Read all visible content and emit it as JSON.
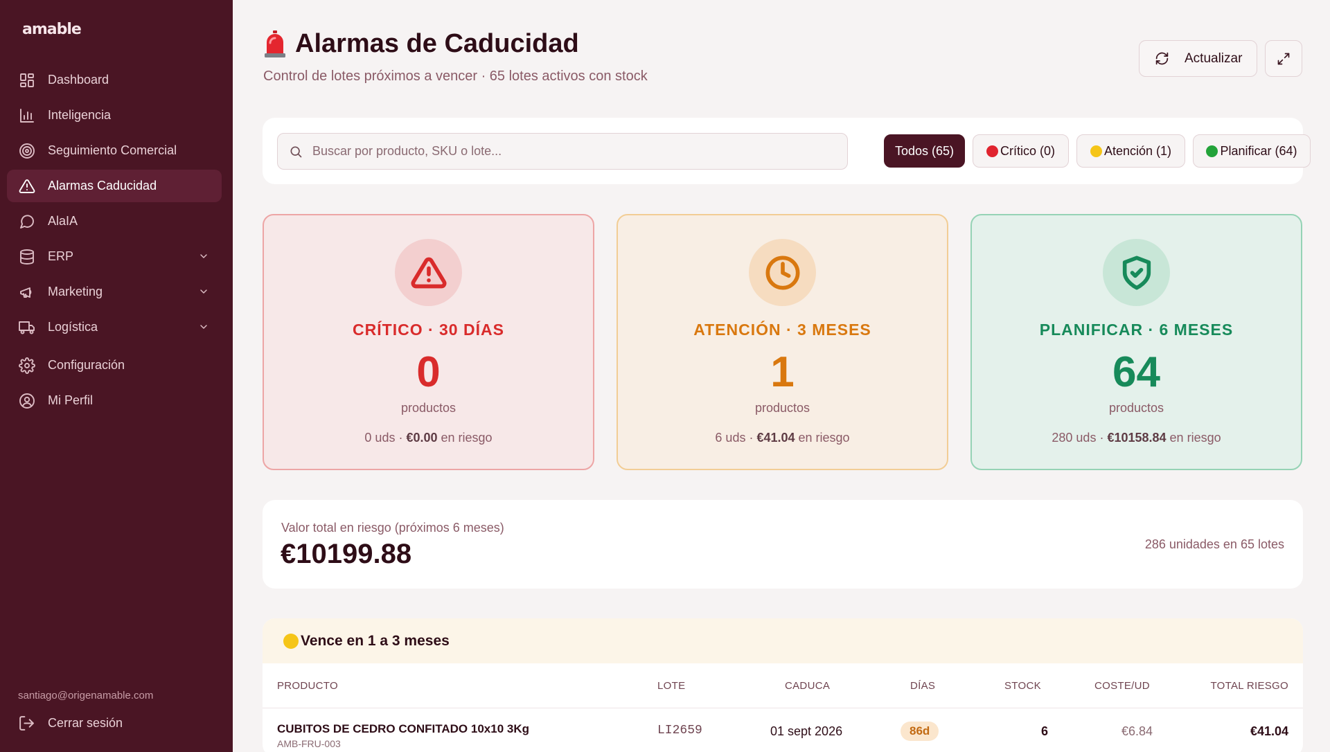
{
  "app": {
    "logo": "amable"
  },
  "sidebar": {
    "items": [
      {
        "label": "Dashboard",
        "icon": "dashboard-icon"
      },
      {
        "label": "Inteligencia",
        "icon": "bar-chart-icon"
      },
      {
        "label": "Seguimiento Comercial",
        "icon": "target-icon"
      },
      {
        "label": "Alarmas Caducidad",
        "icon": "alert-triangle-icon",
        "active": true
      },
      {
        "label": "AlaIA",
        "icon": "message-circle-icon"
      },
      {
        "label": "ERP",
        "icon": "database-icon",
        "expandable": true
      },
      {
        "label": "Marketing",
        "icon": "megaphone-icon",
        "expandable": true
      },
      {
        "label": "Logística",
        "icon": "truck-icon",
        "expandable": true
      },
      {
        "label": "Configuración",
        "icon": "gear-icon"
      },
      {
        "label": "Mi Perfil",
        "icon": "user-circle-icon"
      }
    ],
    "user_email": "santiago@origenamable.com",
    "logout_label": "Cerrar sesión"
  },
  "header": {
    "title": "Alarmas de Caducidad",
    "subtitle": "Control de lotes próximos a vencer · 65 lotes activos con stock",
    "refresh_label": "Actualizar"
  },
  "filters": {
    "search_placeholder": "Buscar por producto, SKU o lote...",
    "search_value": "",
    "chips": [
      {
        "label": "Todos (65)",
        "active": true
      },
      {
        "label": "Crítico (0)",
        "dot_color": "#e0242f"
      },
      {
        "label": "Atención (1)",
        "dot_color": "#f5c518"
      },
      {
        "label": "Planificar (64)",
        "dot_color": "#23a33a"
      }
    ]
  },
  "cards": [
    {
      "title": "CRÍTICO · 30 DÍAS",
      "count": "0",
      "unit": "productos",
      "units": "0 uds · ",
      "value": "€0.00",
      "risk_suffix": " en riesgo",
      "icon": "alert-triangle-icon",
      "color": "#d92b2b"
    },
    {
      "title": "ATENCIÓN · 3 MESES",
      "count": "1",
      "unit": "productos",
      "units": "6 uds · ",
      "value": "€41.04",
      "risk_suffix": " en riesgo",
      "icon": "clock-icon",
      "color": "#d9780f"
    },
    {
      "title": "PLANIFICAR · 6 MESES",
      "count": "64",
      "unit": "productos",
      "units": "280 uds · ",
      "value": "€10158.84",
      "risk_suffix": " en riesgo",
      "icon": "shield-check-icon",
      "color": "#178a5a"
    }
  ],
  "total": {
    "label": "Valor total en riesgo (próximos 6 meses)",
    "value": "€10199.88",
    "summary": "286 unidades en 65 lotes"
  },
  "table": {
    "section_title": "Vence en 1 a 3 meses",
    "section_dot_color": "#f5c518",
    "columns": [
      "PRODUCTO",
      "LOTE",
      "CADUCA",
      "DÍAS",
      "STOCK",
      "COSTE/UD",
      "TOTAL RIESGO"
    ],
    "rows": [
      {
        "product": "CUBITOS DE CEDRO CONFITADO 10x10 3Kg",
        "sku": "AMB-FRU-003",
        "lot": "LI2659",
        "expires": "01 sept 2026",
        "days": "86d",
        "stock": "6",
        "unit_cost": "€6.84",
        "total": "€41.04"
      }
    ]
  }
}
